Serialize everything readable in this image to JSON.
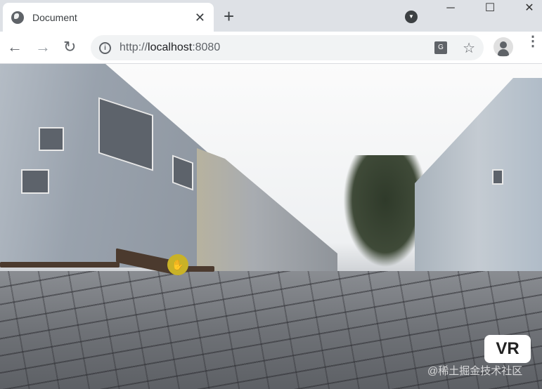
{
  "tab": {
    "title": "Document",
    "close": "✕",
    "new_tab": "+"
  },
  "window": {
    "minimize": "─",
    "maximize": "☐",
    "close": "✕"
  },
  "toolbar": {
    "back": "←",
    "forward": "→",
    "reload": "↻",
    "url_prefix": "http://",
    "url_host": "localhost",
    "url_port": ":8080",
    "translate": "G",
    "bookmark": "☆",
    "menu": "⋮"
  },
  "viewer": {
    "drag_hint": "✋",
    "vr_button": "VR",
    "watermark": "@稀土掘金技术社区"
  }
}
